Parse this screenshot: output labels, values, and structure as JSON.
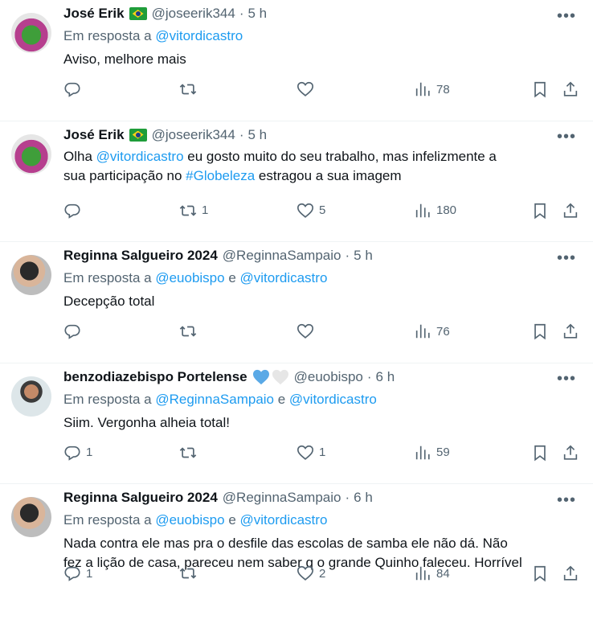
{
  "tweets": [
    {
      "name": "José Erik",
      "flag": true,
      "handle": "@joseerik344",
      "dot": "·",
      "time": "5 h",
      "reply_prefix": "Em resposta a ",
      "reply_mentions": [
        "@vitordicastro"
      ],
      "reply_joiner": "",
      "body_parts": [
        {
          "text": "Aviso, melhore mais",
          "mention": false
        }
      ],
      "replies": "",
      "retweets": "",
      "likes": "",
      "views": "78",
      "avatar": "jose"
    },
    {
      "name": "José Erik",
      "flag": true,
      "handle": "@joseerik344",
      "dot": "·",
      "time": "5 h",
      "reply_prefix": "",
      "reply_mentions": [],
      "body_parts": [
        {
          "text": "Olha ",
          "mention": false
        },
        {
          "text": "@vitordicastro",
          "mention": true
        },
        {
          "text": " eu gosto muito do seu trabalho, mas infelizmente a\nsua participação no ",
          "mention": false
        },
        {
          "text": "#Globeleza",
          "mention": true
        },
        {
          "text": " estragou a sua imagem",
          "mention": false
        }
      ],
      "replies": "",
      "retweets": "1",
      "likes": "5",
      "views": "180",
      "avatar": "jose"
    },
    {
      "name": "Reginna Salgueiro 2024",
      "flag": false,
      "handle": "@ReginnaSampaio",
      "dot": "·",
      "time": "5 h",
      "reply_prefix": "Em resposta a ",
      "reply_mentions": [
        "@euobispo",
        "@vitordicastro"
      ],
      "reply_joiner": " e ",
      "body_parts": [
        {
          "text": "Decepção total",
          "mention": false
        }
      ],
      "replies": "",
      "retweets": "",
      "likes": "",
      "views": "76",
      "avatar": "reginna"
    },
    {
      "name": "benzodiazebispo Portelense",
      "flag": false,
      "hearts": true,
      "handle": "@euobispo",
      "dot": "·",
      "time": "6 h",
      "reply_prefix": "Em resposta a ",
      "reply_mentions": [
        "@ReginnaSampaio",
        "@vitordicastro"
      ],
      "reply_joiner": " e ",
      "body_parts": [
        {
          "text": "Siim. Vergonha alheia total!",
          "mention": false
        }
      ],
      "replies": "1",
      "retweets": "",
      "likes": "1",
      "views": "59",
      "avatar": "benzo"
    },
    {
      "name": "Reginna Salgueiro 2024",
      "flag": false,
      "handle": "@ReginnaSampaio",
      "dot": "·",
      "time": "6 h",
      "reply_prefix": "Em resposta a ",
      "reply_mentions": [
        "@euobispo",
        "@vitordicastro"
      ],
      "reply_joiner": " e ",
      "body_parts": [
        {
          "text": "Nada contra ele mas pra o desfile das escolas de samba ele não dá. Não\nfez a lição de casa, pareceu nem saber q o grande Quinho faleceu. Horrível",
          "mention": false
        }
      ],
      "replies": "1",
      "retweets": "",
      "likes": "2",
      "views": "84",
      "avatar": "reginna"
    }
  ],
  "colors": {
    "text": "#0f1419",
    "secondary": "#536471",
    "link": "#1d9bf0",
    "divider": "#eff3f4",
    "heart_blue": "#5aa9e6",
    "heart_white": "#e6e6e6"
  },
  "icons": {
    "reply": "reply-icon",
    "retweet": "retweet-icon",
    "like": "heart-icon",
    "views": "views-icon",
    "bookmark": "bookmark-icon",
    "share": "share-icon",
    "more": "more-icon"
  },
  "more_label": "•••"
}
